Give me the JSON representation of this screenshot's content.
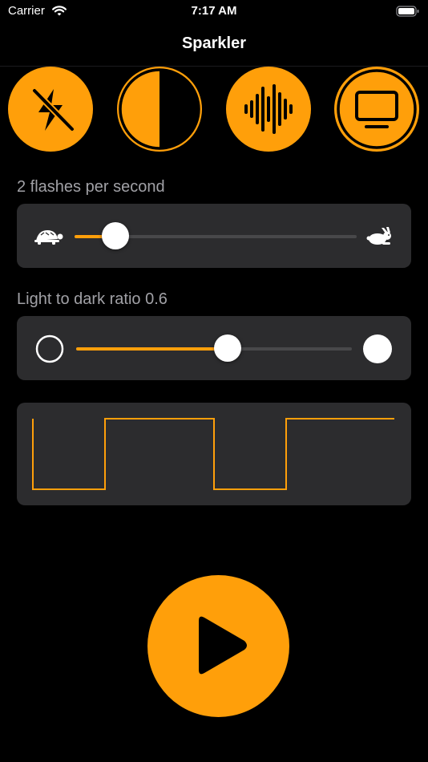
{
  "status_bar": {
    "carrier": "Carrier",
    "time": "7:17 AM",
    "wifi_icon": "wifi-icon",
    "battery_icon": "battery-icon"
  },
  "nav": {
    "title": "Sparkler"
  },
  "modes": [
    {
      "name": "flash-off",
      "icon": "lightning-slash-icon"
    },
    {
      "name": "contrast",
      "icon": "half-circle-icon"
    },
    {
      "name": "sound",
      "icon": "waveform-icon"
    },
    {
      "name": "screen",
      "icon": "display-icon"
    }
  ],
  "frequency": {
    "label": "2 flashes per second",
    "min_icon": "turtle-icon",
    "max_icon": "rabbit-icon",
    "value_fraction": 0.15
  },
  "ratio": {
    "label": "Light to dark ratio 0.6",
    "min_icon": "empty-circle-icon",
    "max_icon": "filled-circle-icon",
    "value_fraction": 0.55
  },
  "waveform": {
    "icon": "square-wave"
  },
  "play": {
    "icon": "play-icon"
  },
  "colors": {
    "accent": "#FF9F0A",
    "background": "#000000",
    "card": "#2c2c2e",
    "label": "#a1a1a6"
  }
}
